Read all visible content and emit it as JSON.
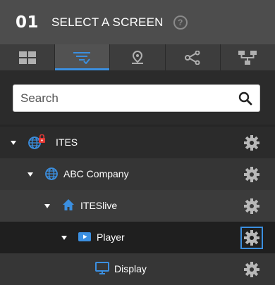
{
  "header": {
    "step": "01",
    "title": "SELECT A SCREEN",
    "help_symbol": "?"
  },
  "tabs": [
    {
      "name": "grid-view",
      "icon": "grid-icon",
      "active": false
    },
    {
      "name": "filter-list-view",
      "icon": "filter-list-icon",
      "active": true
    },
    {
      "name": "location-view",
      "icon": "location-pin-icon",
      "active": false
    },
    {
      "name": "share-view",
      "icon": "share-nodes-icon",
      "active": false
    },
    {
      "name": "hierarchy-view",
      "icon": "hierarchy-icon",
      "active": false
    }
  ],
  "search": {
    "placeholder": "Search",
    "value": ""
  },
  "tree": [
    {
      "label": "ITES",
      "icon": "globe-lock-icon",
      "expanded": true
    },
    {
      "label": "ABC Company",
      "icon": "globe-icon",
      "expanded": true
    },
    {
      "label": "ITESlive",
      "icon": "home-icon",
      "expanded": true
    },
    {
      "label": "Player",
      "icon": "player-icon",
      "expanded": true,
      "settings_selected": true
    },
    {
      "label": "Display",
      "icon": "monitor-icon",
      "expanded": false
    }
  ],
  "colors": {
    "accent": "#3b8fe0",
    "header_bg": "#4d4d4d",
    "icon_gray": "#b0b0b0"
  }
}
